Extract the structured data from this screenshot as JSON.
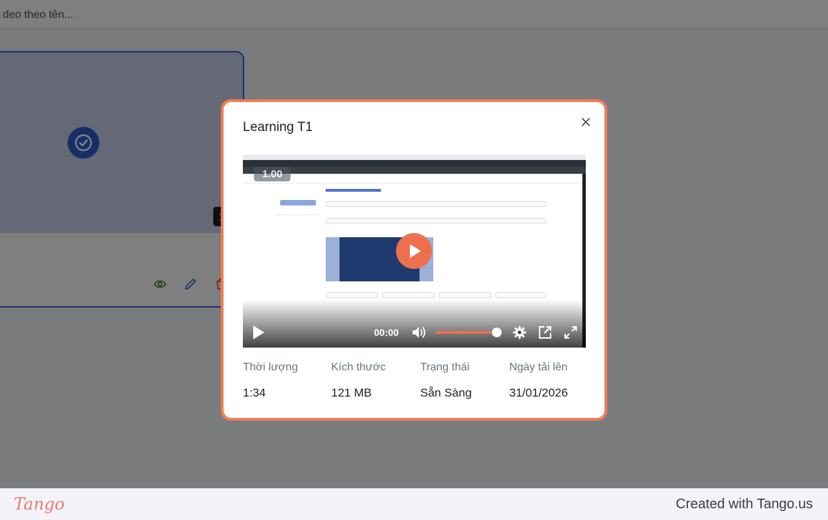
{
  "background": {
    "search_placeholder": "deo theo tên...",
    "video_card": {
      "duration": "1:3",
      "actions": [
        "eye-icon",
        "pencil-icon",
        "trash-icon"
      ]
    }
  },
  "modal": {
    "title": "Learning T1",
    "player": {
      "overlay_speed": "1.00",
      "time": "00:00",
      "volume": 0.9,
      "accent_color": "#ec6f4e"
    },
    "stats": [
      {
        "label": "Thời lượng",
        "value": "1:34"
      },
      {
        "label": "Kích thước",
        "value": "121 MB"
      },
      {
        "label": "Trạng thái",
        "value": "Sẵn Sàng"
      },
      {
        "label": "Ngày tải lên",
        "value": "31/01/2026"
      }
    ]
  },
  "footer": {
    "brand": "Tango",
    "credit": "Created with Tango.us"
  },
  "colors": {
    "modal_border": "#ef7d54",
    "card_border": "#3b5fd4"
  }
}
